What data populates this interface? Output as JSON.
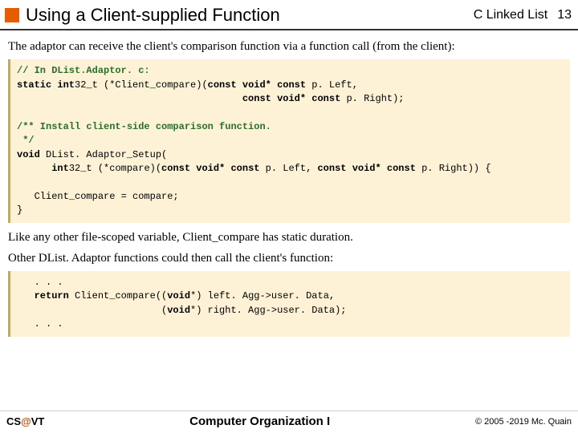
{
  "header": {
    "title": "Using a Client-supplied Function",
    "topic": "C Linked List",
    "page": "13"
  },
  "body": {
    "intro": "The adaptor can receive the client's comparison function via a function call (from the client):",
    "code1_comment": "// In DList.Adaptor. c:",
    "code1_l1a": "static int",
    "code1_l1b": "32_t (*Client_compare)(",
    "code1_l1c": "const void* const",
    "code1_l1d": " p. Left,",
    "code1_l2pad": "                                       ",
    "code1_l2a": "const void* const",
    "code1_l2b": " p. Right);",
    "code1_doc1": "/** Install client-side comparison function.",
    "code1_doc2": " */",
    "code1_sig1a": "void",
    "code1_sig1b": " DList. Adaptor_Setup(",
    "code1_sig2pad": "      ",
    "code1_sig2a": "int",
    "code1_sig2b": "32_t (*compare)(",
    "code1_sig2c": "const void* const",
    "code1_sig2d": " p. Left, ",
    "code1_sig2e": "const void* const",
    "code1_sig2f": " p. Right)) {",
    "code1_body": "   Client_compare = compare;",
    "code1_end": "}",
    "mid1": "Like any other file-scoped variable, Client_compare has static duration.",
    "mid2": "Other DList. Adaptor functions could then call the client's function:",
    "code2_l1": "   . . .",
    "code2_l2a": "   ",
    "code2_l2b": "return",
    "code2_l2c": " Client_compare((",
    "code2_l2d": "void",
    "code2_l2e": "*) left. Agg->user. Data,",
    "code2_l3pad": "                         (",
    "code2_l3a": "void",
    "code2_l3b": "*) right. Agg->user. Data);",
    "code2_l4": "   . . ."
  },
  "footer": {
    "left_a": "CS",
    "left_at": "@",
    "left_b": "VT",
    "mid": "Computer Organization I",
    "right": "© 2005 -2019 Mc. Quain"
  }
}
